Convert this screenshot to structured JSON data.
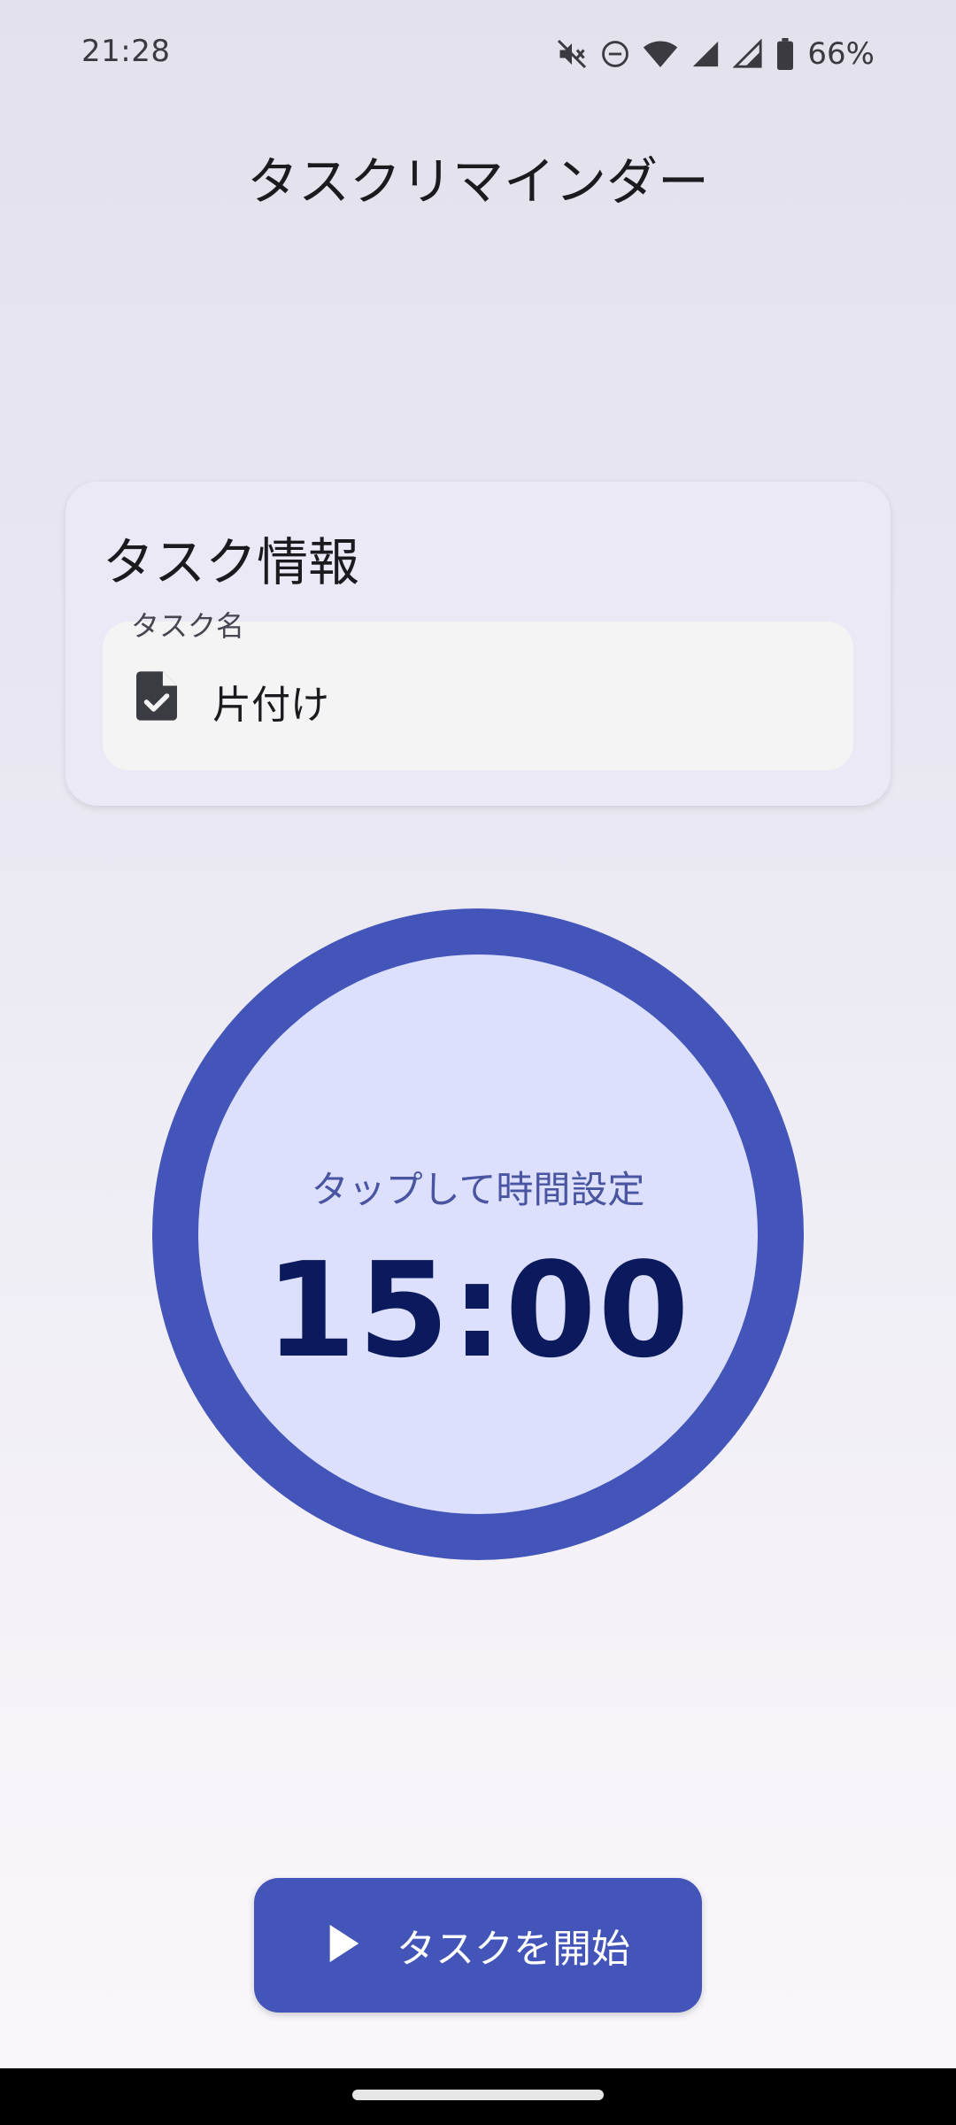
{
  "status_bar": {
    "time": "21:28",
    "battery_percent": "66%",
    "icons": [
      "mute-icon",
      "dnd-icon",
      "wifi-icon",
      "signal-icon",
      "signal-icon",
      "battery-icon"
    ]
  },
  "header": {
    "title": "タスクリマインダー"
  },
  "task_card": {
    "title": "タスク情報",
    "field_label": "タスク名",
    "field_value": "片付け",
    "field_icon": "task-document-icon"
  },
  "timer": {
    "hint": "タップして時間設定",
    "value": "15:00",
    "ring_color": "#4355b9",
    "inner_color": "#dde0fd"
  },
  "start_button": {
    "label": "タスクを開始",
    "icon": "play-icon",
    "color": "#4355b9"
  }
}
